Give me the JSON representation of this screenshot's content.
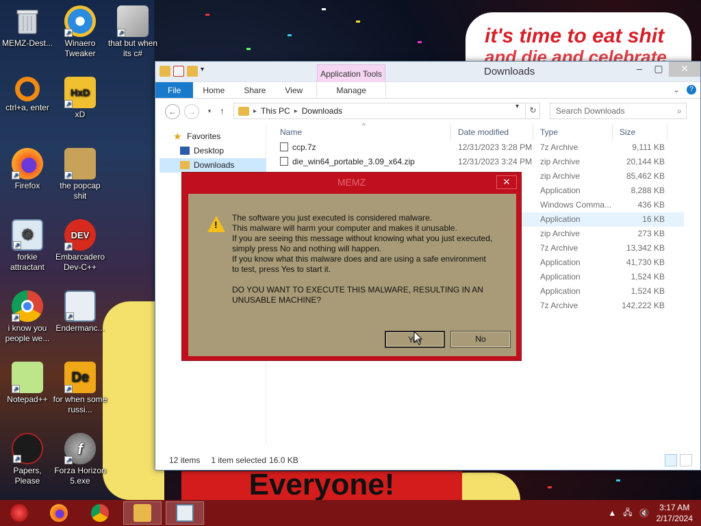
{
  "wallpaper": {
    "banner_top_line1": "it's time to eat shit",
    "banner_top_line2": "and die and celebrate",
    "banner_bottom": "Everyone!"
  },
  "desktop_icons": [
    {
      "label": "MEMZ-Dest...",
      "icon": "recycle-bin-icon"
    },
    {
      "label": "Winaero Tweaker",
      "icon": "winaero-icon"
    },
    {
      "label": "that but when its c#",
      "icon": "stacked-windows-icon"
    },
    {
      "label": "ctrl+a, enter",
      "icon": "orange-ring-icon"
    },
    {
      "label": "xD",
      "icon": "hxd-icon"
    },
    {
      "label": "Firefox",
      "icon": "firefox-icon"
    },
    {
      "label": "the popcap shit",
      "icon": "popcap-icon"
    },
    {
      "label": "forkie attractant",
      "icon": "settings-monitor-icon"
    },
    {
      "label": "Embarcadero Dev-C++",
      "icon": "devcpp-icon"
    },
    {
      "label": "i know you people we...",
      "icon": "chrome-icon"
    },
    {
      "label": "Endermanc...",
      "icon": "window-app-icon"
    },
    {
      "label": "Notepad++",
      "icon": "notepadpp-icon"
    },
    {
      "label": "for when some russi...",
      "icon": "de-icon"
    },
    {
      "label": "Papers, Please",
      "icon": "papers-please-icon"
    },
    {
      "label": "Forza Horizon 5.exe",
      "icon": "flash-icon"
    }
  ],
  "explorer": {
    "title": "Downloads",
    "context_tab": "Application Tools",
    "tabs": [
      "File",
      "Home",
      "Share",
      "View",
      "Manage"
    ],
    "address": {
      "root": "This PC",
      "current": "Downloads"
    },
    "search_placeholder": "Search Downloads",
    "nav": {
      "favorites": "Favorites",
      "items": [
        "Desktop",
        "Downloads"
      ]
    },
    "columns": {
      "name": "Name",
      "date": "Date modified",
      "type": "Type",
      "size": "Size"
    },
    "files": [
      {
        "name": "ccp.7z",
        "date": "12/31/2023 3:28 PM",
        "type": "7z Archive",
        "size": "9,111 KB"
      },
      {
        "name": "die_win64_portable_3.09_x64.zip",
        "date": "12/31/2023 3:24 PM",
        "type": "zip Archive",
        "size": "20,144 KB"
      },
      {
        "name": "",
        "date": "",
        "type": "zip Archive",
        "size": "85,462 KB"
      },
      {
        "name": "",
        "date": "",
        "type": "Application",
        "size": "8,288 KB"
      },
      {
        "name": "",
        "date": "",
        "type": "Windows Comma...",
        "size": "436 KB"
      },
      {
        "name": "",
        "date": "M",
        "type": "Application",
        "size": "16 KB"
      },
      {
        "name": "",
        "date": "M",
        "type": "zip Archive",
        "size": "273 KB"
      },
      {
        "name": "",
        "date": "M",
        "type": "7z Archive",
        "size": "13,342 KB"
      },
      {
        "name": "",
        "date": "M",
        "type": "Application",
        "size": "41,730 KB"
      },
      {
        "name": "",
        "date": "M",
        "type": "Application",
        "size": "1,524 KB"
      },
      {
        "name": "",
        "date": "M",
        "type": "Application",
        "size": "1,524 KB"
      },
      {
        "name": "",
        "date": "M",
        "type": "7z Archive",
        "size": "142,222 KB"
      }
    ],
    "status": {
      "count": "12 items",
      "selected": "1 item selected",
      "size": "16.0 KB"
    }
  },
  "dialog": {
    "title": "MEMZ",
    "lines": [
      "The software you just executed is considered malware.",
      "This malware will harm your computer and makes it unusable.",
      "If you are seeing this message without knowing what you just executed,",
      "simply press No and nothing will happen.",
      "If you know what this malware does and are using a safe environment",
      "to test, press Yes to start it."
    ],
    "question_1": "DO YOU WANT TO EXECUTE THIS MALWARE, RESULTING IN AN",
    "question_2": "UNUSABLE MACHINE?",
    "yes": "Yes",
    "no": "No",
    "colors": {
      "frame": "#c0101e",
      "body": "#a99b77"
    }
  },
  "taskbar": {
    "time": "3:17 AM",
    "date": "2/17/2024",
    "color": "#7a1414"
  }
}
